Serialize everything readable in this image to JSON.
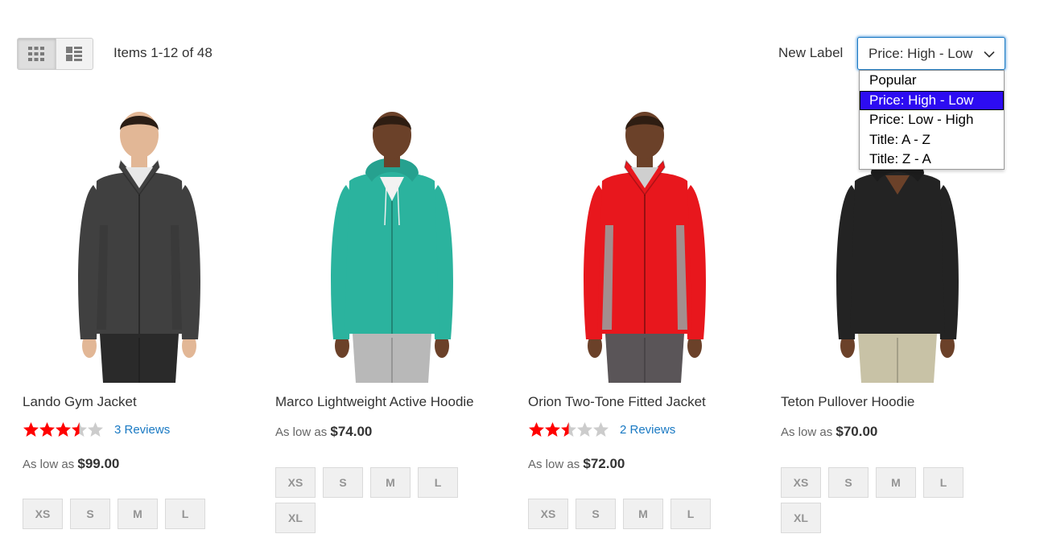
{
  "toolbar": {
    "view_modes": [
      {
        "name": "grid",
        "icon": "grid-icon",
        "active": true
      },
      {
        "name": "list",
        "icon": "list-icon",
        "active": false
      }
    ],
    "items_count": "Items 1-12 of 48",
    "sort_label": "New Label",
    "sort_value": "Price: High - Low",
    "sort_options": [
      "Popular",
      "Price: High - Low",
      "Price: Low - High",
      "Title: A - Z",
      "Title: Z - A"
    ],
    "selected_option": "Price: High - Low"
  },
  "colors": {
    "link": "#1979c3",
    "star_filled": "#ff0000",
    "star_empty": "#cccccc",
    "dropdown_selected": "#2d0cf2",
    "focus_border": "#1979c3"
  },
  "products": [
    {
      "name": "Lando Gym Jacket",
      "rating": 3.5,
      "reviews": "3 Reviews",
      "price_prefix": "As low as",
      "price": "$99.00",
      "sizes": [
        "XS",
        "S",
        "M",
        "L"
      ],
      "image": {
        "type": "jacket",
        "body": "#404040",
        "inner": "#3a3a3a",
        "shirt": "#e8e8e8",
        "pants": "#2a2a2a",
        "skin": "#e2b796",
        "hair": "#2a1d15"
      }
    },
    {
      "name": "Marco Lightweight Active Hoodie",
      "rating": null,
      "reviews": null,
      "price_prefix": "As low as",
      "price": "$74.00",
      "sizes": [
        "XS",
        "S",
        "M",
        "L",
        "XL"
      ],
      "image": {
        "type": "hoodie",
        "body": "#2bb39e",
        "inner": "#26a18f",
        "shirt": "#f2f2f2",
        "pants": "#b8b8b8",
        "skin": "#6b4129",
        "hair": "#2e1d12"
      }
    },
    {
      "name": "Orion Two-Tone Fitted Jacket",
      "rating": 2.5,
      "reviews": "2 Reviews",
      "price_prefix": "As low as",
      "price": "$72.00",
      "sizes": [
        "XS",
        "S",
        "M",
        "L"
      ],
      "image": {
        "type": "jacket",
        "body": "#e8171d",
        "inner": "#9b9b9b",
        "shirt": "#cfcfcf",
        "pants": "#5a5558",
        "skin": "#6b4129",
        "hair": "#2e1d12"
      }
    },
    {
      "name": "Teton Pullover Hoodie",
      "rating": null,
      "reviews": null,
      "price_prefix": "As low as",
      "price": "$70.00",
      "sizes": [
        "XS",
        "S",
        "M",
        "L",
        "XL"
      ],
      "image": {
        "type": "hoodie-dark",
        "body": "#232323",
        "inner": "#1c1c1c",
        "shirt": "#232323",
        "pants": "#c8c2a6",
        "skin": "#6b4129",
        "hair": "#2e1d12"
      }
    }
  ]
}
